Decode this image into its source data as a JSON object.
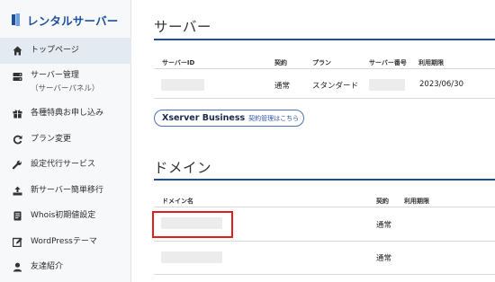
{
  "brand": {
    "title": "レンタルサーバー",
    "color": "#1d4f9c"
  },
  "sidebar": {
    "items": [
      {
        "label": "トップページ",
        "icon": "home-icon",
        "active": true
      },
      {
        "label": "サーバー管理",
        "sub": "（サーバーパネル）",
        "icon": "server-icon"
      },
      {
        "label": "各種特典お申し込み",
        "icon": "gift-icon"
      },
      {
        "label": "プラン変更",
        "icon": "refresh-icon"
      },
      {
        "label": "設定代行サービス",
        "icon": "wrench-icon"
      },
      {
        "label": "新サーバー簡単移行",
        "icon": "upload-icon"
      },
      {
        "label": "Whois初期値設定",
        "icon": "document-icon"
      },
      {
        "label": "WordPressテーマ",
        "icon": "edit-icon"
      },
      {
        "label": "友達紹介",
        "icon": "user-icon"
      }
    ]
  },
  "server": {
    "title": "サーバー",
    "headers": {
      "id": "サーバーID",
      "contract": "契約",
      "plan": "プラン",
      "number": "サーバー番号",
      "expiry": "利用期限"
    },
    "row": {
      "id": "",
      "contract": "通常",
      "plan": "スタンダード",
      "number": "",
      "expiry": "2023/06/30"
    },
    "business_button": {
      "brand": "Xserver Business",
      "link": "契約管理はこちら"
    }
  },
  "domain": {
    "title": "ドメイン",
    "headers": {
      "name": "ドメイン名",
      "contract": "契約",
      "expiry": "利用期限"
    },
    "rows": [
      {
        "name": "",
        "contract": "通常"
      },
      {
        "name": "",
        "contract": "通常"
      }
    ]
  },
  "colors": {
    "accent": "#1d4f9c",
    "highlight": "#e01e1e",
    "active_bg": "#e4eaf2"
  }
}
